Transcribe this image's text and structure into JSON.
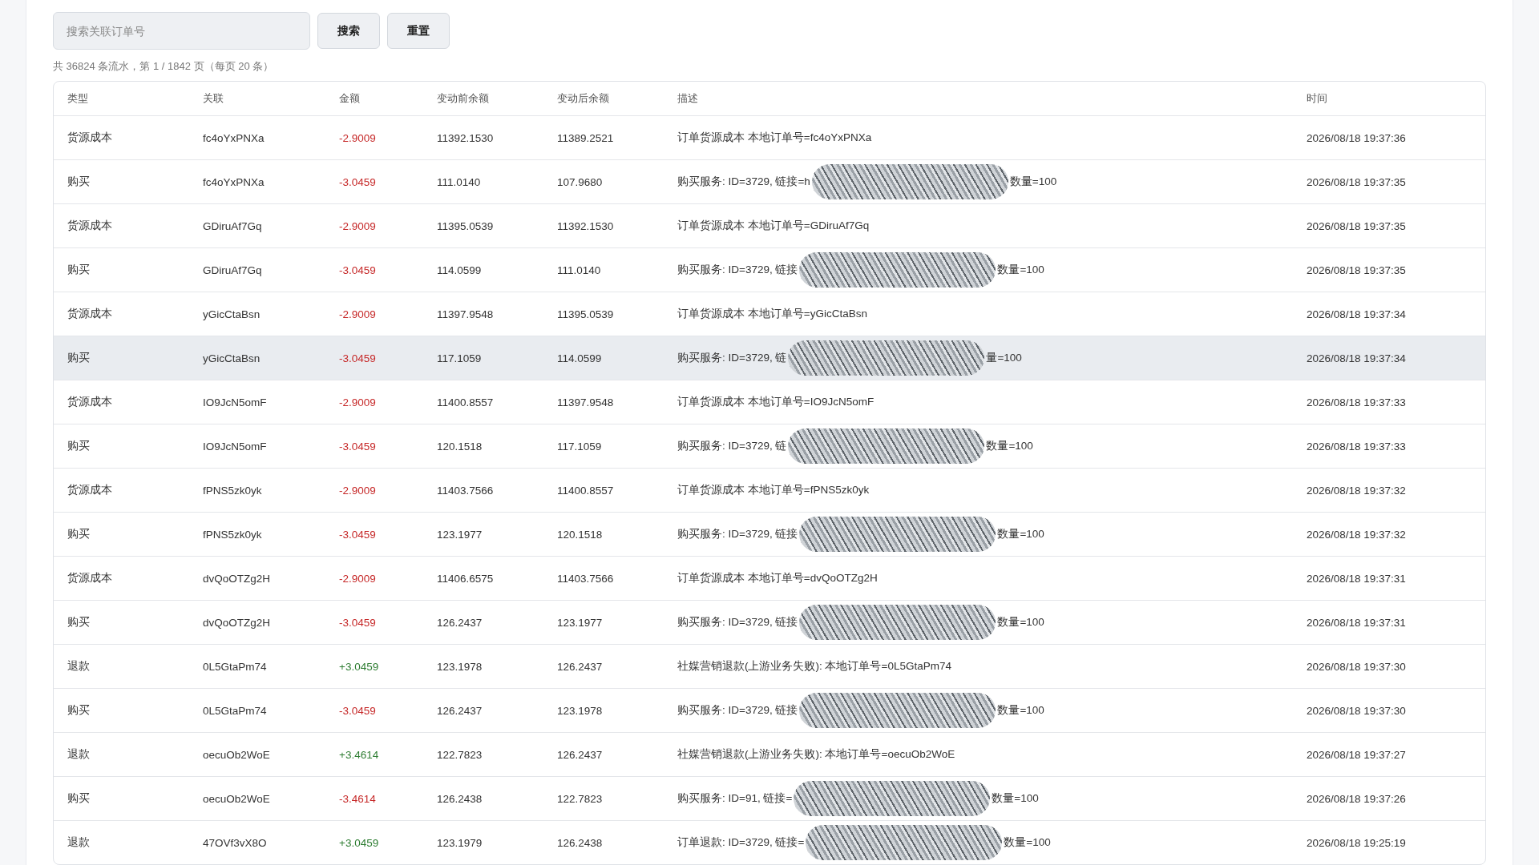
{
  "search": {
    "placeholder": "搜索关联订单号",
    "buttons": [
      "搜索",
      "重置"
    ]
  },
  "summary": "共 36824 条流水，第 1 / 1842 页（每页 20 条）",
  "table": {
    "columns": [
      "类型",
      "关联",
      "金额",
      "变动前余额",
      "变动后余额",
      "描述",
      "时间"
    ],
    "rows": [
      {
        "type": "货源成本",
        "ref": "fc4oYxPNXa",
        "amount": "-2.9009",
        "color": "#c62828",
        "before": "11392.1530",
        "after": "11389.2521",
        "desc": {
          "text": "订单货源成本 本地订单号=fc4oYxPNXa",
          "redacted": false
        },
        "time": "2026/08/18 19:37:36",
        "highlighted": false
      },
      {
        "type": "购买",
        "ref": "fc4oYxPNXa",
        "amount": "-3.0459",
        "color": "#c62828",
        "before": "111.0140",
        "after": "107.9680",
        "desc": {
          "text": "购买服务: ID=3729, 链接=h",
          "redacted": true,
          "tail": "数量=100"
        },
        "time": "2026/08/18 19:37:35",
        "highlighted": false
      },
      {
        "type": "货源成本",
        "ref": "GDiruAf7Gq",
        "amount": "-2.9009",
        "color": "#c62828",
        "before": "11395.0539",
        "after": "11392.1530",
        "desc": {
          "text": "订单货源成本 本地订单号=GDiruAf7Gq",
          "redacted": false
        },
        "time": "2026/08/18 19:37:35",
        "highlighted": false
      },
      {
        "type": "购买",
        "ref": "GDiruAf7Gq",
        "amount": "-3.0459",
        "color": "#c62828",
        "before": "114.0599",
        "after": "111.0140",
        "desc": {
          "text": "购买服务: ID=3729, 链接",
          "redacted": true,
          "tail": "数量=100"
        },
        "time": "2026/08/18 19:37:35",
        "highlighted": false
      },
      {
        "type": "货源成本",
        "ref": "yGicCtaBsn",
        "amount": "-2.9009",
        "color": "#c62828",
        "before": "11397.9548",
        "after": "11395.0539",
        "desc": {
          "text": "订单货源成本 本地订单号=yGicCtaBsn",
          "redacted": false
        },
        "time": "2026/08/18 19:37:34",
        "highlighted": false
      },
      {
        "type": "购买",
        "ref": "yGicCtaBsn",
        "amount": "-3.0459",
        "color": "#c62828",
        "before": "117.1059",
        "after": "114.0599",
        "desc": {
          "text": "购买服务: ID=3729, 链",
          "redacted": true,
          "tail": "量=100"
        },
        "time": "2026/08/18 19:37:34",
        "highlighted": true
      },
      {
        "type": "货源成本",
        "ref": "IO9JcN5omF",
        "amount": "-2.9009",
        "color": "#c62828",
        "before": "11400.8557",
        "after": "11397.9548",
        "desc": {
          "text": "订单货源成本 本地订单号=IO9JcN5omF",
          "redacted": false
        },
        "time": "2026/08/18 19:37:33",
        "highlighted": false
      },
      {
        "type": "购买",
        "ref": "IO9JcN5omF",
        "amount": "-3.0459",
        "color": "#c62828",
        "before": "120.1518",
        "after": "117.1059",
        "desc": {
          "text": "购买服务: ID=3729, 链",
          "redacted": true,
          "tail": "数量=100"
        },
        "time": "2026/08/18 19:37:33",
        "highlighted": false
      },
      {
        "type": "货源成本",
        "ref": "fPNS5zk0yk",
        "amount": "-2.9009",
        "color": "#c62828",
        "before": "11403.7566",
        "after": "11400.8557",
        "desc": {
          "text": "订单货源成本 本地订单号=fPNS5zk0yk",
          "redacted": false
        },
        "time": "2026/08/18 19:37:32",
        "highlighted": false
      },
      {
        "type": "购买",
        "ref": "fPNS5zk0yk",
        "amount": "-3.0459",
        "color": "#c62828",
        "before": "123.1977",
        "after": "120.1518",
        "desc": {
          "text": "购买服务: ID=3729, 链接",
          "redacted": true,
          "tail": "数量=100"
        },
        "time": "2026/08/18 19:37:32",
        "highlighted": false
      },
      {
        "type": "货源成本",
        "ref": "dvQoOTZg2H",
        "amount": "-2.9009",
        "color": "#c62828",
        "before": "11406.6575",
        "after": "11403.7566",
        "desc": {
          "text": "订单货源成本 本地订单号=dvQoOTZg2H",
          "redacted": false
        },
        "time": "2026/08/18 19:37:31",
        "highlighted": false
      },
      {
        "type": "购买",
        "ref": "dvQoOTZg2H",
        "amount": "-3.0459",
        "color": "#c62828",
        "before": "126.2437",
        "after": "123.1977",
        "desc": {
          "text": "购买服务: ID=3729, 链接",
          "redacted": true,
          "tail": "数量=100"
        },
        "time": "2026/08/18 19:37:31",
        "highlighted": false
      },
      {
        "type": "退款",
        "ref": "0L5GtaPm74",
        "amount": "+3.0459",
        "color": "#2e7d32",
        "before": "123.1978",
        "after": "126.2437",
        "desc": {
          "text": "社媒营销退款(上游业务失败): 本地订单号=0L5GtaPm74",
          "redacted": false
        },
        "time": "2026/08/18 19:37:30",
        "highlighted": false
      },
      {
        "type": "购买",
        "ref": "0L5GtaPm74",
        "amount": "-3.0459",
        "color": "#c62828",
        "before": "126.2437",
        "after": "123.1978",
        "desc": {
          "text": "购买服务: ID=3729, 链接",
          "redacted": true,
          "tail": "数量=100"
        },
        "time": "2026/08/18 19:37:30",
        "highlighted": false
      },
      {
        "type": "退款",
        "ref": "oecuOb2WoE",
        "amount": "+3.4614",
        "color": "#2e7d32",
        "before": "122.7823",
        "after": "126.2437",
        "desc": {
          "text": "社媒营销退款(上游业务失败): 本地订单号=oecuOb2WoE",
          "redacted": false
        },
        "time": "2026/08/18 19:37:27",
        "highlighted": false
      },
      {
        "type": "购买",
        "ref": "oecuOb2WoE",
        "amount": "-3.4614",
        "color": "#c62828",
        "before": "126.2438",
        "after": "122.7823",
        "desc": {
          "text": "购买服务: ID=91, 链接=",
          "redacted": true,
          "tail": "数量=100"
        },
        "time": "2026/08/18 19:37:26",
        "highlighted": false
      },
      {
        "type": "退款",
        "ref": "47OVf3vX8O",
        "amount": "+3.0459",
        "color": "#2e7d32",
        "before": "123.1979",
        "after": "126.2438",
        "desc": {
          "text": "订单退款: ID=3729, 链接=",
          "redacted": true,
          "tail": "数量=100"
        },
        "time": "2026/08/18 19:25:19",
        "highlighted": false
      }
    ]
  }
}
